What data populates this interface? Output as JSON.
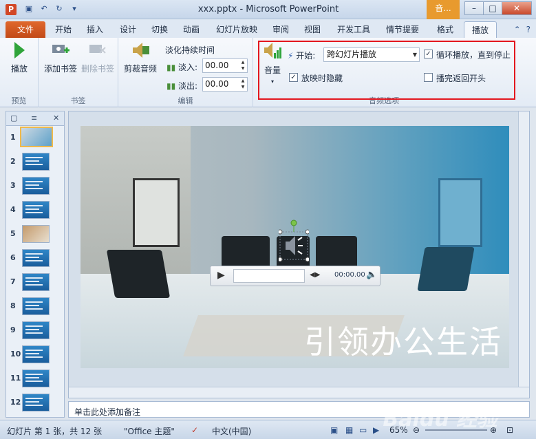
{
  "window": {
    "title": "xxx.pptx - Microsoft PowerPoint",
    "context_tab_group": "音...",
    "app_icon": "P"
  },
  "tabs": [
    "文件",
    "开始",
    "插入",
    "设计",
    "切换",
    "动画",
    "幻灯片放映",
    "审阅",
    "视图",
    "开发工具",
    "情节提要",
    "格式",
    "播放"
  ],
  "active_tab": "播放",
  "ribbon": {
    "preview": {
      "play_label": "播放",
      "group_label": "预览"
    },
    "bookmarks": {
      "add_label": "添加书签",
      "remove_label": "删除书签",
      "group_label": "书签"
    },
    "editing": {
      "trim_label": "剪裁音频",
      "fade_title": "淡化持续时间",
      "fade_in_label": "淡入:",
      "fade_in_value": "00.00",
      "fade_out_label": "淡出:",
      "fade_out_value": "00.00",
      "group_label": "编辑"
    },
    "audio_options": {
      "volume_label": "音量",
      "start_label": "开始:",
      "start_value": "跨幻灯片播放",
      "hide_label": "放映时隐藏",
      "hide_checked": true,
      "loop_label": "循环播放，直到停止",
      "loop_checked": true,
      "rewind_label": "播完返回开头",
      "rewind_checked": false,
      "group_label": "音频选项"
    }
  },
  "slides": [
    1,
    2,
    3,
    4,
    5,
    6,
    7,
    8,
    9,
    10,
    11,
    12
  ],
  "current_slide": 1,
  "slide": {
    "title_text": "引领办公生活",
    "player_time": "00:00.00"
  },
  "notes_placeholder": "单击此处添加备注",
  "status": {
    "slide_info": "幻灯片 第 1 张，共 12 张",
    "theme": "\"Office 主题\"",
    "language": "中文(中国)",
    "zoom": "65%"
  },
  "watermark": "Baidu 经验"
}
